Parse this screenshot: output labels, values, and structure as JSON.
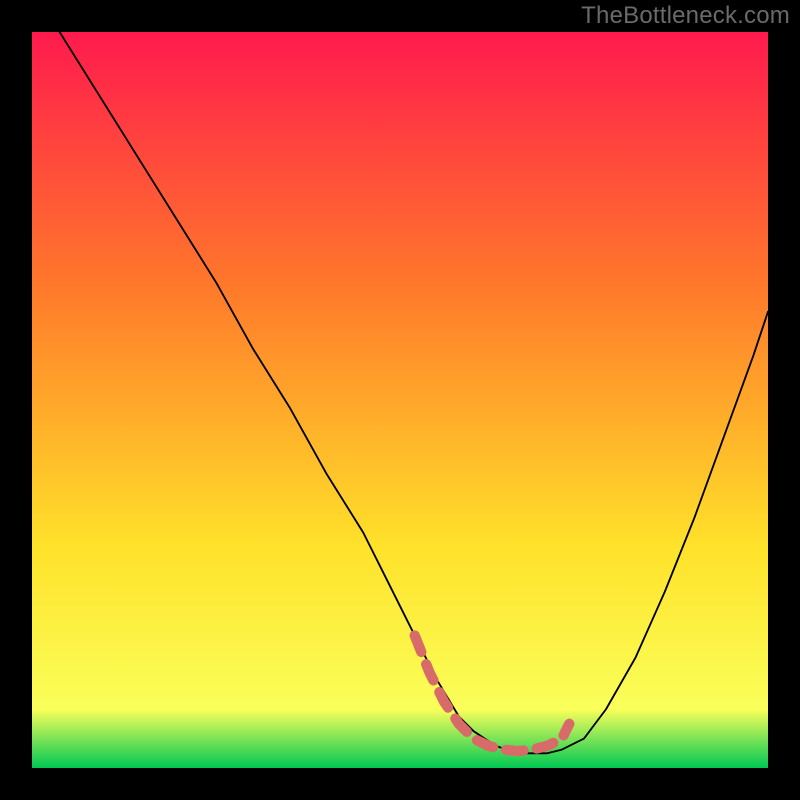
{
  "watermark": "TheBottleneck.com",
  "colors": {
    "page_bg": "#000000",
    "gradient_top": "#ff1a4d",
    "gradient_upper_mid": "#ff7a2a",
    "gradient_mid": "#ffe22a",
    "gradient_lower": "#faff5a",
    "band_green_dark": "#00c853",
    "band_green_light": "#6aff5a",
    "curve_stroke": "#000000",
    "annotation_stroke": "#d96a6a",
    "watermark_text": "#6a6a6a"
  },
  "chart_data": {
    "type": "line",
    "title": "",
    "xlabel": "",
    "ylabel": "",
    "xlim": [
      0,
      100
    ],
    "ylim": [
      0,
      100
    ],
    "grid": false,
    "series": [
      {
        "name": "bottleneck-curve",
        "x": [
          0,
          5,
          10,
          15,
          20,
          25,
          30,
          35,
          40,
          45,
          50,
          52,
          55,
          58,
          60,
          63,
          66,
          70,
          72,
          75,
          78,
          82,
          86,
          90,
          94,
          98,
          100
        ],
        "values": [
          106,
          98,
          90,
          82,
          74,
          66,
          57,
          49,
          40,
          32,
          22,
          18,
          12,
          7,
          5,
          3,
          2,
          2,
          2.5,
          4,
          8,
          15,
          24,
          34,
          45,
          56,
          62
        ]
      }
    ],
    "annotations": [
      {
        "name": "optimal-range-marker",
        "style": "thick-dashed",
        "color": "#d96a6a",
        "x": [
          52,
          54,
          56,
          58,
          60,
          62,
          64,
          66,
          68,
          70,
          72,
          73
        ],
        "values": [
          18,
          13,
          9,
          6,
          4,
          3,
          2.5,
          2.3,
          2.5,
          3,
          4,
          6
        ]
      }
    ],
    "background": {
      "type": "vertical-gradient",
      "stops": [
        {
          "offset": 0.0,
          "color": "#ff1a4d"
        },
        {
          "offset": 0.35,
          "color": "#ff7a2a"
        },
        {
          "offset": 0.7,
          "color": "#ffe22a"
        },
        {
          "offset": 0.92,
          "color": "#faff5a"
        },
        {
          "offset": 1.0,
          "color": "#00c853"
        }
      ],
      "green_band_stripes_pct_height": [
        0.6,
        0.7,
        0.8,
        0.9,
        1.0,
        1.1,
        1.2,
        1.3
      ],
      "green_band_top_from_bottom_pct": 7.5
    }
  }
}
